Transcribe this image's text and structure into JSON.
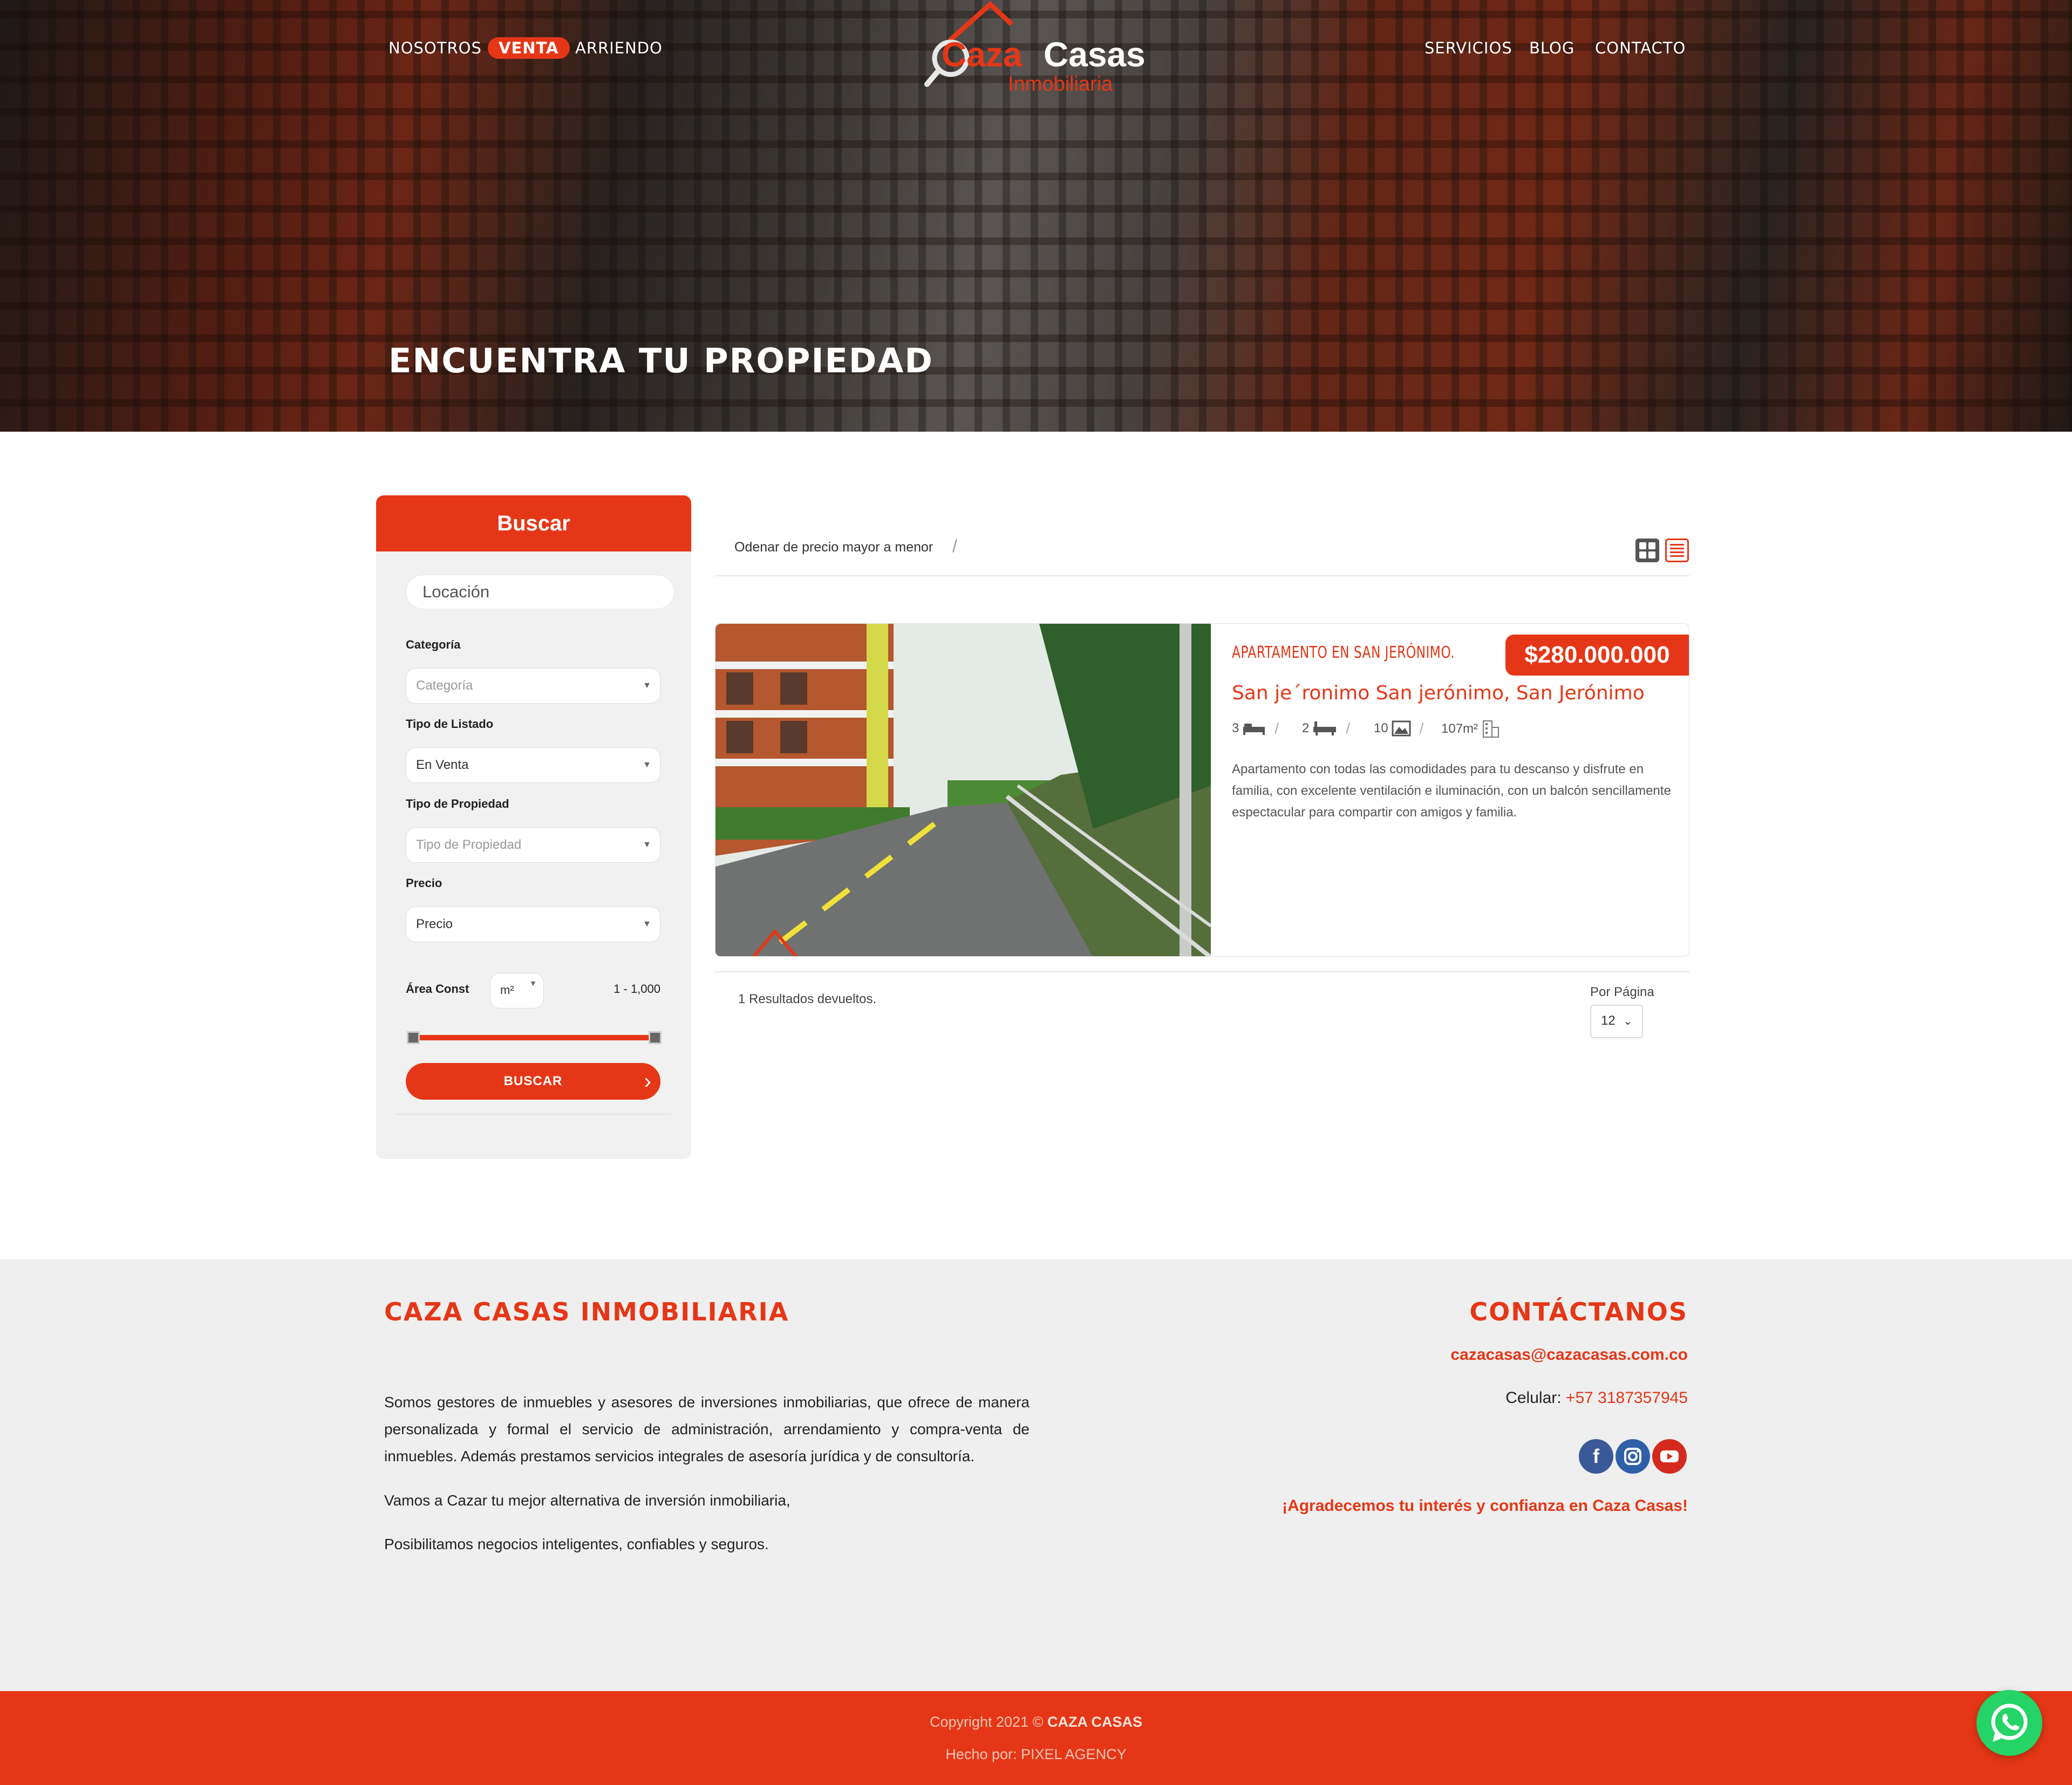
{
  "nav": {
    "left": [
      "NOSOTROS",
      "VENTA",
      "ARRIENDO"
    ],
    "right": [
      "SERVICIOS",
      "BLOG",
      "CONTACTO"
    ],
    "active": "VENTA"
  },
  "logo": {
    "word1": "Caza",
    "word2": "Casas",
    "sub": "Inmobiliaria"
  },
  "hero": {
    "title": "ENCUENTRA TU PROPIEDAD"
  },
  "search": {
    "title": "Buscar",
    "location_placeholder": "Locación",
    "category_label": "Categoría",
    "category_value": "Categoría",
    "listing_label": "Tipo de Listado",
    "listing_value": "En Venta",
    "property_label": "Tipo de Propiedad",
    "property_value": "Tipo de Propiedad",
    "price_label": "Precio",
    "price_value": "Precio",
    "area_label": "Área Const",
    "area_unit": "m²",
    "area_range": "1 - 1,000",
    "button": "BUSCAR"
  },
  "results": {
    "sort_label": "Odenar de precio mayor a menor",
    "count_text": "1 Resultados devueltos.",
    "per_page_label": "Por Página",
    "per_page_value": "12"
  },
  "listing": {
    "type": "APARTAMENTO EN SAN JERÓNIMO.",
    "price": "$280.000.000",
    "location": "San je´ronimo San jerónimo, San Jerónimo",
    "bedrooms": "3",
    "bathrooms": "2",
    "photos": "10",
    "area": "107m²",
    "description": "Apartamento con todas las comodidades para tu descanso y disfrute en familia, con excelente ventilación e iluminación, con un balcón sencillamente espectacular para compartir con amigos y familia."
  },
  "footer": {
    "left_title": "CAZA CASAS INMOBILIARIA",
    "left_paragraph": "Somos gestores de inmuebles y asesores de inversiones inmobiliarias, que ofrece de manera personalizada y formal el servicio de administración, arrendamiento y compra-venta de inmuebles. Además prestamos servicios integrales de asesoría jurídica y de consultoría.",
    "left_line2": "Vamos a Cazar tu mejor alternativa de inversión inmobiliaria,",
    "left_line3": "Posibilitamos negocios inteligentes, confiables y seguros.",
    "right_title": "CONTÁCTANOS",
    "email": "cazacasas@cazacasas.com.co",
    "phone_label": "Celular:",
    "phone": "+57 3187357945",
    "thanks": "¡Agradecemos tu interés y confianza en Caza Casas!",
    "copyright_prefix": "Copyright 2021 ©",
    "copyright_brand": "CAZA CASAS",
    "made_by": "Hecho por: PIXEL AGENCY"
  },
  "colors": {
    "accent": "#e53717",
    "footer_bg": "#efefef",
    "whatsapp": "#25d366",
    "facebook": "#3b5998",
    "instagram": "#2f5fa8",
    "youtube": "#d42a1e"
  },
  "icons": [
    "bed-icon",
    "bathtub-icon",
    "image-icon",
    "building-icon",
    "grid-view-icon",
    "list-view-icon",
    "facebook-icon",
    "instagram-icon",
    "youtube-icon",
    "whatsapp-icon",
    "magnifier-icon"
  ]
}
